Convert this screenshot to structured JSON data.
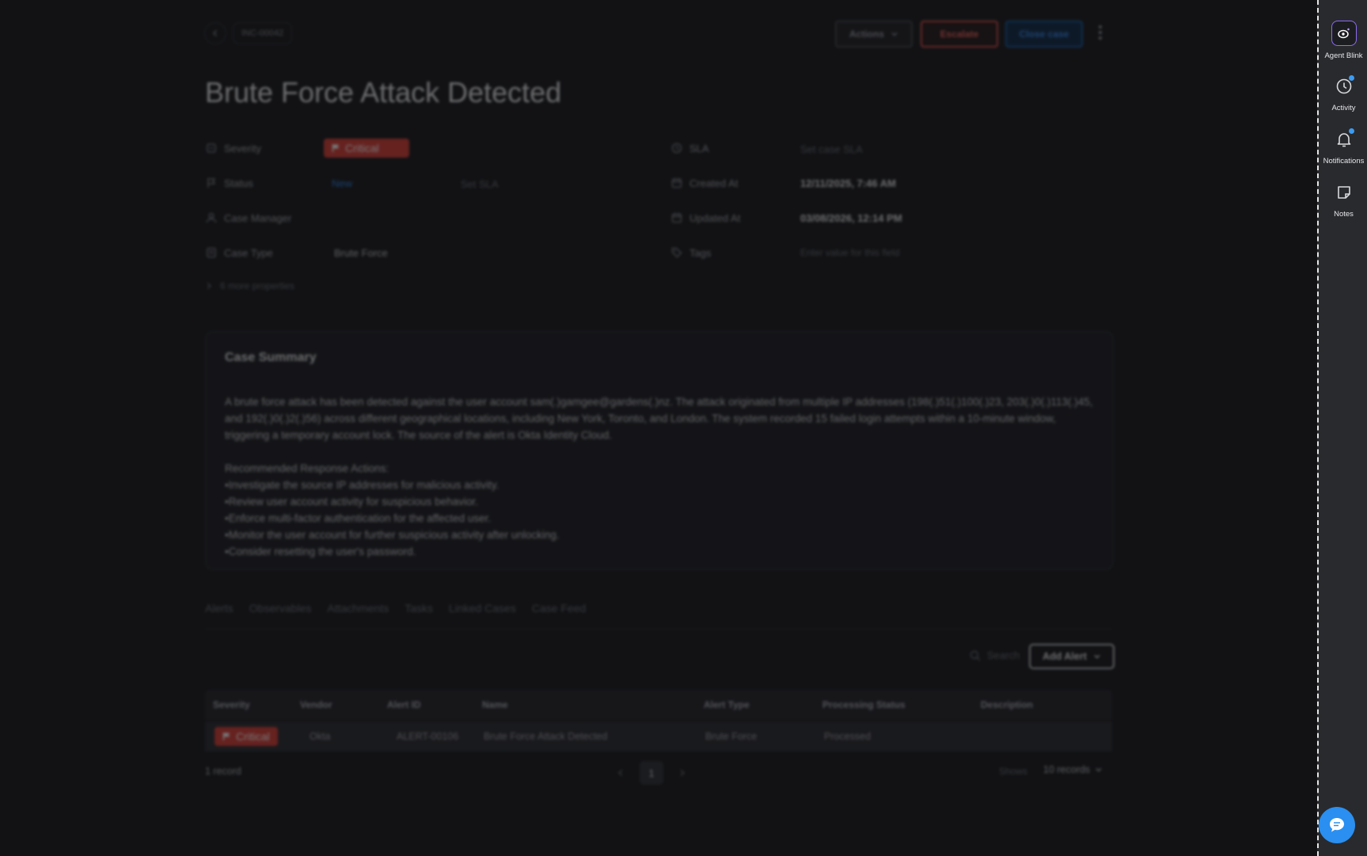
{
  "header": {
    "case_id": "INC-00042",
    "actions_label": "Actions",
    "escalate_label": "Escalate",
    "close_label": "Close case"
  },
  "title": "Brute Force Attack Detected",
  "properties": {
    "severity": {
      "label": "Severity",
      "value": "Critical"
    },
    "status": {
      "label": "Status",
      "value": "New",
      "sla_action": "Set SLA"
    },
    "case_manager": {
      "label": "Case Manager",
      "value": ""
    },
    "case_type": {
      "label": "Case Type",
      "value": "Brute Force"
    },
    "sla": {
      "label": "SLA",
      "value": "Set case SLA"
    },
    "created_at": {
      "label": "Created At",
      "value": "12/11/2025, 7:46 AM"
    },
    "updated_at": {
      "label": "Updated At",
      "value": "03/08/2026, 12:14 PM"
    },
    "tags": {
      "label": "Tags",
      "placeholder": "Enter value for this field"
    },
    "more": "6 more properties"
  },
  "summary": {
    "title": "Case Summary",
    "paragraph": "A brute force attack has been detected against the user account sam(.)gamgee@gardens(.)nz. The attack originated from multiple IP addresses (198(.)51(.)100(.)23, 203(.)0(.)113(.)45, and 192(.)0(.)2(.)56) across different geographical locations, including New York, Toronto, and London. The system recorded 15 failed login attempts within a 10-minute window, triggering a temporary account lock. The source of the alert is Okta Identity Cloud.",
    "actions_heading": "Recommended Response Actions:",
    "actions": [
      "Investigate the source IP addresses for malicious activity.",
      "Review user account activity for suspicious behavior.",
      "Enforce multi-factor authentication for the affected user.",
      "Monitor the user account for further suspicious activity after unlocking.",
      "Consider resetting the user's password."
    ]
  },
  "tabs": [
    "Alerts",
    "Observables",
    "Attachments",
    "Tasks",
    "Linked Cases",
    "Case Feed"
  ],
  "alerts": {
    "search_placeholder": "Search",
    "add_label": "Add Alert",
    "columns": [
      "Severity",
      "Vendor",
      "Alert ID",
      "Name",
      "Alert Type",
      "Processing Status",
      "Description"
    ],
    "rows": [
      {
        "severity": "Critical",
        "vendor": "Okta",
        "alert_id": "ALERT-00106",
        "name": "Brute Force Attack Detected",
        "alert_type": "Brute Force",
        "processing_status": "Processed",
        "description": ""
      }
    ],
    "record_count": "1 record",
    "page": "1",
    "shows_label": "Shows",
    "per_page": "10 records"
  },
  "rail": {
    "agent": "Agent Blink",
    "activity": "Activity",
    "notifications": "Notifications",
    "notes": "Notes"
  },
  "colors": {
    "critical": "#d8433b",
    "accent": "#2f86e6",
    "escalate": "#e2554f"
  }
}
